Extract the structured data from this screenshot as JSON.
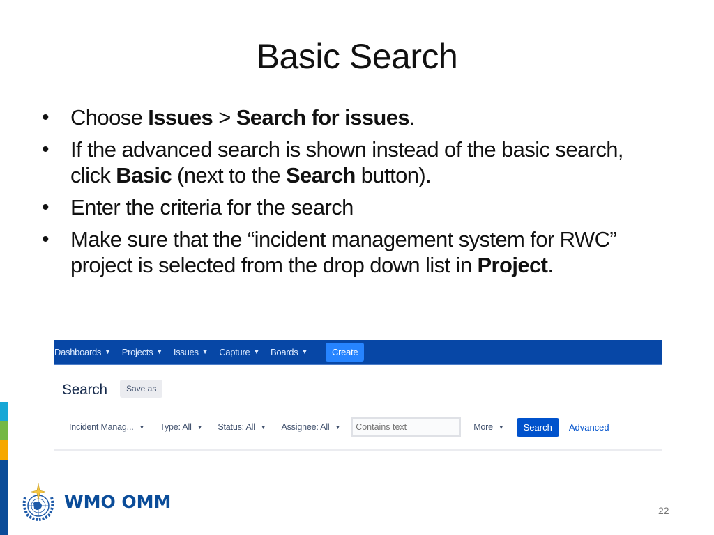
{
  "slide": {
    "title": "Basic Search",
    "page_number": "22"
  },
  "bullets": [
    {
      "parts": [
        {
          "t": "Choose ",
          "b": false
        },
        {
          "t": "Issues",
          "b": true
        },
        {
          "t": " > ",
          "b": false
        },
        {
          "t": "Search for issues",
          "b": true
        },
        {
          "t": ".",
          "b": false
        }
      ]
    },
    {
      "parts": [
        {
          "t": "If the advanced search is shown instead of the basic search, click ",
          "b": false
        },
        {
          "t": "Basic",
          "b": true
        },
        {
          "t": " (next to the ",
          "b": false
        },
        {
          "t": "Search",
          "b": true
        },
        {
          "t": " button).",
          "b": false
        }
      ]
    },
    {
      "parts": [
        {
          "t": "Enter the criteria for the search",
          "b": false
        }
      ]
    },
    {
      "parts": [
        {
          "t": "Make sure that the “incident management system for RWC” project is selected from the drop down list in ",
          "b": false
        },
        {
          "t": "Project",
          "b": true
        },
        {
          "t": ".",
          "b": false
        }
      ]
    }
  ],
  "screenshot": {
    "nav": {
      "items": [
        "Dashboards",
        "Projects",
        "Issues",
        "Capture",
        "Boards"
      ],
      "create_label": "Create",
      "chevron_icon": "chevron-down-icon"
    },
    "page_title": "Search",
    "save_as_label": "Save as",
    "filters": {
      "project": "Incident Manag...",
      "type": "Type: All",
      "status": "Status: All",
      "assignee": "Assignee: All",
      "text_placeholder": "Contains text",
      "more": "More",
      "search_button": "Search",
      "advanced_link": "Advanced"
    }
  },
  "footer": {
    "logo_text": "WMO OMM",
    "logo_icon": "un-emblem-icon"
  },
  "colors": {
    "nav_bg": "#0747a6",
    "create_bg": "#2684ff",
    "search_btn_bg": "#0052cc",
    "stripe": [
      "#17a7d6",
      "#74b844",
      "#f6a800",
      "#0a4c99"
    ],
    "brand_blue": "#0a4c99"
  }
}
